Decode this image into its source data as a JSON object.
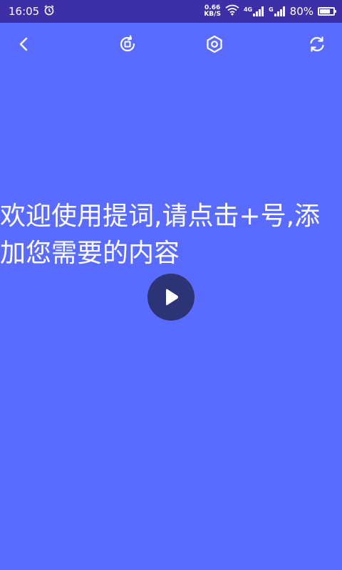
{
  "status_bar": {
    "time": "16:05",
    "net_speed_value": "0.66",
    "net_speed_unit": "KB/S",
    "network_type": "4G",
    "sim2_label": "G",
    "battery": "80%",
    "battery_level": 0.8
  },
  "toolbar": {
    "back_icon": "back-arrow-icon",
    "rotate_icon": "screen-rotate-icon",
    "settings_icon": "hexagon-settings-icon",
    "refresh_icon": "refresh-icon"
  },
  "content": {
    "prompt_text": "欢迎使用提词,请点击+号,添加您需要的内容",
    "play_icon": "play-icon"
  },
  "colors": {
    "background": "#5a6cff",
    "status_bar": "#3d2fa8",
    "play_button": "#2d3476",
    "text": "#ffffff"
  }
}
